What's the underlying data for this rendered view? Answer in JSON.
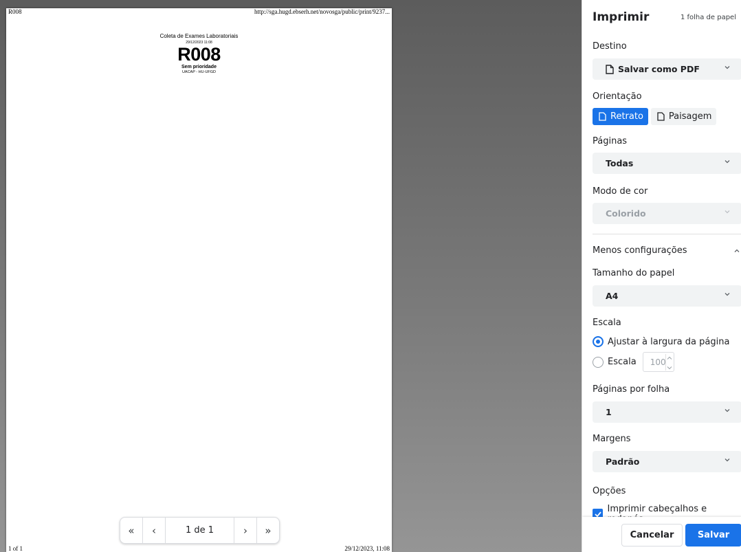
{
  "preview": {
    "header_left": "R008",
    "header_right": "http://sga.hugd.ebserh.net/novosga/public/print/9237...",
    "footer_left": "1 of 1",
    "footer_right": "29/12/2023, 11:08",
    "ticket": {
      "title": "Coleta de Exames Laboratoriais",
      "datetime": "29/12/2023 11:08",
      "code": "R008",
      "priority": "Sem prioridade",
      "unit": "UACAP - HU-UFGD"
    },
    "page_nav": {
      "first_icon": "«",
      "prev_icon": "‹",
      "page_info": "1 de 1",
      "next_icon": "›",
      "last_icon": "»"
    }
  },
  "sidebar": {
    "title": "Imprimir",
    "sheet_count": "1 folha de papel",
    "destination": {
      "label": "Destino",
      "value": "Salvar como PDF"
    },
    "orientation": {
      "label": "Orientação",
      "portrait": "Retrato",
      "landscape": "Paisagem",
      "selected": "Retrato"
    },
    "pages": {
      "label": "Páginas",
      "value": "Todas"
    },
    "color": {
      "label": "Modo de cor",
      "value": "Colorido"
    },
    "more_settings": "Menos configurações",
    "paper_size": {
      "label": "Tamanho do papel",
      "value": "A4"
    },
    "scale": {
      "label": "Escala",
      "fit_option": "Ajustar à largura da página",
      "custom_option": "Escala",
      "custom_value": "100"
    },
    "pages_per_sheet": {
      "label": "Páginas por folha",
      "value": "1"
    },
    "margins": {
      "label": "Margens",
      "value": "Padrão"
    },
    "options": {
      "label": "Opções",
      "headers_footers": "Imprimir cabeçalhos e rodapés"
    },
    "cancel_label": "Cancelar",
    "save_label": "Salvar"
  },
  "colors": {
    "accent": "#1a73e8",
    "select_bg": "#f1f3f4",
    "preview_bg": "#6b6b6b"
  }
}
